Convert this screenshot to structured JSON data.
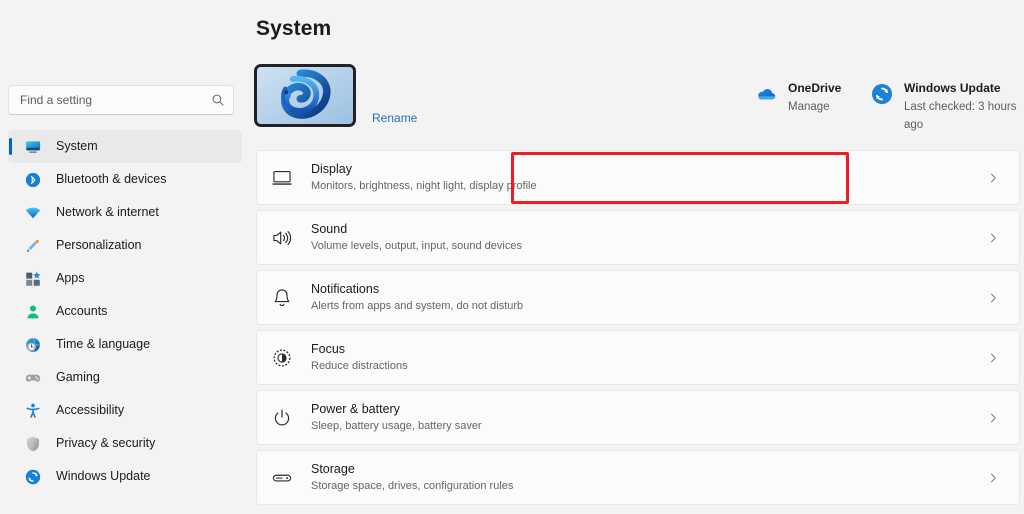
{
  "window": {
    "title": "System"
  },
  "sidebar": {
    "search": {
      "placeholder": "Find a setting",
      "value": "",
      "icon": "search-icon"
    },
    "items": [
      {
        "id": "system",
        "label": "System",
        "icon": "monitor-icon",
        "selected": true
      },
      {
        "id": "bluetooth-devices",
        "label": "Bluetooth & devices",
        "icon": "bluetooth-icon",
        "selected": false
      },
      {
        "id": "network-internet",
        "label": "Network & internet",
        "icon": "wifi-icon",
        "selected": false
      },
      {
        "id": "personalization",
        "label": "Personalization",
        "icon": "paintbrush-icon",
        "selected": false
      },
      {
        "id": "apps",
        "label": "Apps",
        "icon": "apps-grid-icon",
        "selected": false
      },
      {
        "id": "accounts",
        "label": "Accounts",
        "icon": "person-icon",
        "selected": false
      },
      {
        "id": "time-language",
        "label": "Time & language",
        "icon": "clock-globe-icon",
        "selected": false
      },
      {
        "id": "gaming",
        "label": "Gaming",
        "icon": "gamepad-icon",
        "selected": false
      },
      {
        "id": "accessibility",
        "label": "Accessibility",
        "icon": "accessibility-icon",
        "selected": false
      },
      {
        "id": "privacy-security",
        "label": "Privacy & security",
        "icon": "shield-icon",
        "selected": false
      },
      {
        "id": "windows-update",
        "label": "Windows Update",
        "icon": "sync-icon",
        "selected": false
      }
    ]
  },
  "header": {
    "page_title": "System",
    "device_thumbnail_icon": "windows-11-bloom-wallpaper",
    "rename_label": "Rename",
    "status": [
      {
        "id": "onedrive",
        "title": "OneDrive",
        "subtitle": "Manage",
        "icon": "onedrive-cloud-icon"
      },
      {
        "id": "windows-update",
        "title": "Windows Update",
        "subtitle": "Last checked: 3 hours ago",
        "icon": "sync-icon"
      }
    ]
  },
  "main": {
    "rows": [
      {
        "id": "display",
        "title": "Display",
        "subtitle": "Monitors, brightness, night light, display profile",
        "icon": "monitor-outline-icon",
        "chevron": "chevron-right-icon"
      },
      {
        "id": "sound",
        "title": "Sound",
        "subtitle": "Volume levels, output, input, sound devices",
        "icon": "speaker-waves-icon",
        "chevron": "chevron-right-icon"
      },
      {
        "id": "notifications",
        "title": "Notifications",
        "subtitle": "Alerts from apps and system, do not disturb",
        "icon": "bell-icon",
        "chevron": "chevron-right-icon"
      },
      {
        "id": "focus",
        "title": "Focus",
        "subtitle": "Reduce distractions",
        "icon": "focus-moon-icon",
        "chevron": "chevron-right-icon"
      },
      {
        "id": "power-battery",
        "title": "Power & battery",
        "subtitle": "Sleep, battery usage, battery saver",
        "icon": "power-icon",
        "chevron": "chevron-right-icon"
      },
      {
        "id": "storage",
        "title": "Storage",
        "subtitle": "Storage space, drives, configuration rules",
        "icon": "drive-icon",
        "chevron": "chevron-right-icon"
      }
    ]
  },
  "annotation": {
    "highlight_target": "display",
    "highlight_color": "#ed1c29"
  },
  "colors": {
    "page_background": "#f3f3f3",
    "card_background": "#fbfbfb",
    "accent": "#0067c0",
    "link": "#2a6fb8",
    "text_primary": "#1b1b1b",
    "text_secondary": "#656565",
    "selected_nav_background": "#e9e9e9"
  }
}
